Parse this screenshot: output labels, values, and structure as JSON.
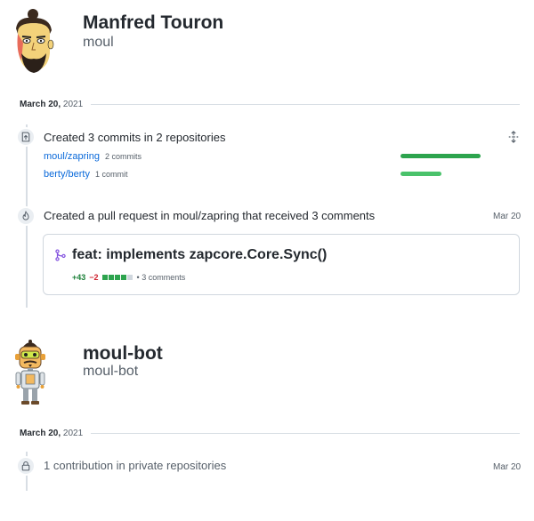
{
  "users": [
    {
      "name": "Manfred Touron",
      "login": "moul",
      "avatar_icon": "cartoon-man-avatar",
      "date": {
        "day": "March 20,",
        "year": "2021"
      },
      "activities": [
        {
          "icon": "repo-push-icon",
          "title": "Created 3 commits in 2 repositories",
          "action_icon": "unfold-icon",
          "repos": [
            {
              "name": "moul/zapring",
              "count": "2 commits",
              "fraction": 1.0
            },
            {
              "name": "berty/berty",
              "count": "1 commit",
              "fraction": 0.5
            }
          ]
        },
        {
          "icon": "pull-request-icon",
          "title": "Created a pull request in moul/zapring that received 3 comments",
          "date": "Mar 20",
          "pr": {
            "icon": "git-merge-icon",
            "title": "feat: implements zapcore.Core.Sync()",
            "additions": "+43",
            "deletions": "−2",
            "comments": "• 3 comments"
          }
        }
      ]
    },
    {
      "name": "moul-bot",
      "login": "moul-bot",
      "avatar_icon": "robot-avatar",
      "date": {
        "day": "March 20,",
        "year": "2021"
      },
      "activities": [
        {
          "icon": "lock-icon",
          "title": "1 contribution in private repositories",
          "date": "Mar 20"
        }
      ]
    }
  ],
  "colors": {
    "bar_green_dark": "#2da44e",
    "bar_green_light": "#4ac26b",
    "link": "#0969da",
    "add": "#1a7f37",
    "del": "#cf222e"
  }
}
